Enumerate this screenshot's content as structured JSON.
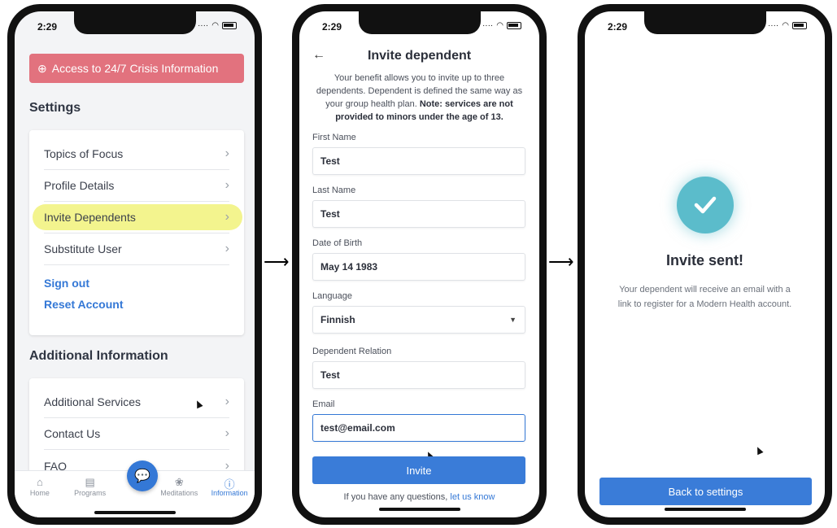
{
  "status_time": "2:29",
  "settings_screen": {
    "crisis_banner": "Access to 24/7 Crisis Information",
    "settings_title": "Settings",
    "settings_items": [
      {
        "label": "Topics of Focus"
      },
      {
        "label": "Profile Details"
      },
      {
        "label": "Invite Dependents"
      },
      {
        "label": "Substitute User"
      }
    ],
    "sign_out": "Sign out",
    "reset_account": "Reset Account",
    "additional_title": "Additional Information",
    "additional_items": [
      {
        "label": "Additional Services"
      },
      {
        "label": "Contact Us"
      },
      {
        "label": "FAQ"
      }
    ],
    "tabs": [
      {
        "label": "Home",
        "icon": "home-icon"
      },
      {
        "label": "Programs",
        "icon": "book-icon"
      },
      {
        "label": "Meditations",
        "icon": "lotus-icon"
      },
      {
        "label": "Information",
        "icon": "info-icon",
        "active": true
      }
    ]
  },
  "invite_screen": {
    "title": "Invite dependent",
    "intro_text": "Your benefit allows you to invite up to three dependents. Dependent is defined the same way as your group health plan.",
    "intro_bold": "Note: services are not provided to minors under the age of 13.",
    "fields": [
      {
        "label": "First Name",
        "value": "Test"
      },
      {
        "label": "Last Name",
        "value": "Test"
      },
      {
        "label": "Date of Birth",
        "value": "May 14 1983"
      },
      {
        "label": "Language",
        "value": "Finnish"
      },
      {
        "label": "Dependent Relation",
        "value": "Test"
      },
      {
        "label": "Email",
        "value": "test@email.com"
      }
    ],
    "invite_button": "Invite",
    "help_text": "If you have any questions,",
    "help_link": "let us know"
  },
  "confirmation_screen": {
    "title": "Invite sent!",
    "message": "Your dependent will receive an email with a link to register for a Modern Health account.",
    "back_button": "Back to settings"
  },
  "colors": {
    "accent": "#3478d6",
    "crisis": "#e2727e",
    "highlight": "#f3f48e",
    "success": "#5bbccb"
  }
}
